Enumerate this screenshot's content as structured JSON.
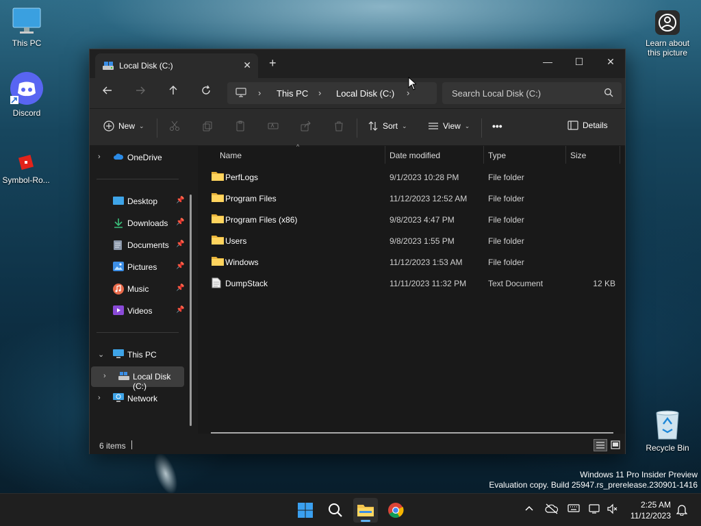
{
  "desktop": {
    "icons": [
      {
        "label": "This PC"
      },
      {
        "label": "Discord"
      },
      {
        "label": "Symbol-Ro..."
      },
      {
        "label": "Recycle Bin"
      }
    ],
    "learn_label": "Learn about this picture",
    "watermark_line1": "Windows 11 Pro Insider Preview",
    "watermark_line2": "Evaluation copy. Build 25947.rs_prerelease.230901-1416"
  },
  "window": {
    "tab_title": "Local Disk (C:)",
    "new_tab": "+",
    "controls": {
      "minimize": "—",
      "maximize": "☐",
      "close": "✕"
    },
    "address": {
      "crumbs": [
        "This PC",
        "Local Disk (C:)"
      ]
    },
    "search_placeholder": "Search Local Disk (C:)",
    "toolbar": {
      "new_label": "New",
      "sort_label": "Sort",
      "view_label": "View",
      "more_label": "•••",
      "details_label": "Details"
    },
    "sidebar": {
      "onedrive": "OneDrive",
      "quick": [
        {
          "label": "Desktop",
          "icon": "desktop-icon"
        },
        {
          "label": "Downloads",
          "icon": "downloads-icon"
        },
        {
          "label": "Documents",
          "icon": "documents-icon"
        },
        {
          "label": "Pictures",
          "icon": "pictures-icon"
        },
        {
          "label": "Music",
          "icon": "music-icon"
        },
        {
          "label": "Videos",
          "icon": "videos-icon"
        }
      ],
      "this_pc": "This PC",
      "local_disk": "Local Disk (C:)",
      "network": "Network"
    },
    "columns": {
      "name": "Name",
      "date": "Date modified",
      "type": "Type",
      "size": "Size"
    },
    "files": [
      {
        "name": "PerfLogs",
        "date": "9/1/2023 10:28 PM",
        "type": "File folder",
        "size": "",
        "kind": "folder"
      },
      {
        "name": "Program Files",
        "date": "11/12/2023 12:52 AM",
        "type": "File folder",
        "size": "",
        "kind": "folder"
      },
      {
        "name": "Program Files (x86)",
        "date": "9/8/2023 4:47 PM",
        "type": "File folder",
        "size": "",
        "kind": "folder"
      },
      {
        "name": "Users",
        "date": "9/8/2023 1:55 PM",
        "type": "File folder",
        "size": "",
        "kind": "folder"
      },
      {
        "name": "Windows",
        "date": "11/12/2023 1:53 AM",
        "type": "File folder",
        "size": "",
        "kind": "folder"
      },
      {
        "name": "DumpStack",
        "date": "11/11/2023 11:32 PM",
        "type": "Text Document",
        "size": "12 KB",
        "kind": "file"
      }
    ],
    "status_count": "6 items"
  },
  "taskbar": {
    "time": "2:25 AM",
    "date": "11/12/2023",
    "accent": "#5fb2f2"
  }
}
